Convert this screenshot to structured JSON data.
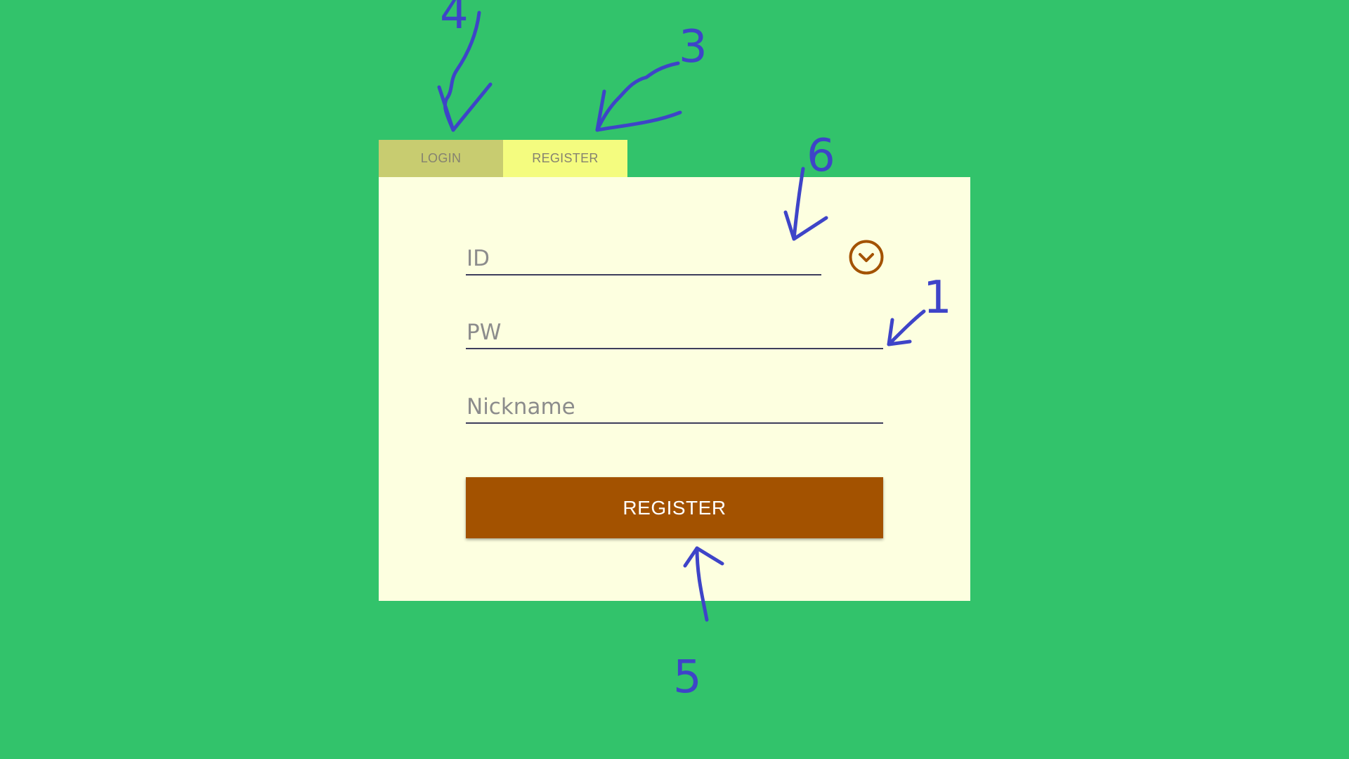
{
  "tabs": {
    "login_label": "LOGIN",
    "register_label": "REGISTER",
    "active": "register"
  },
  "form": {
    "id_placeholder": "ID",
    "pw_placeholder": "PW",
    "nickname_placeholder": "Nickname",
    "check_icon": "chevron-down-circle-icon",
    "submit_label": "REGISTER"
  },
  "annotations": {
    "labels": [
      "1",
      "3",
      "4",
      "5",
      "6"
    ],
    "color": "#3e44c8"
  },
  "colors": {
    "background": "#32c36b",
    "card": "#fdffe0",
    "tab_login": "#c8cc70",
    "tab_register": "#f4fc7f",
    "accent": "#a35200"
  }
}
